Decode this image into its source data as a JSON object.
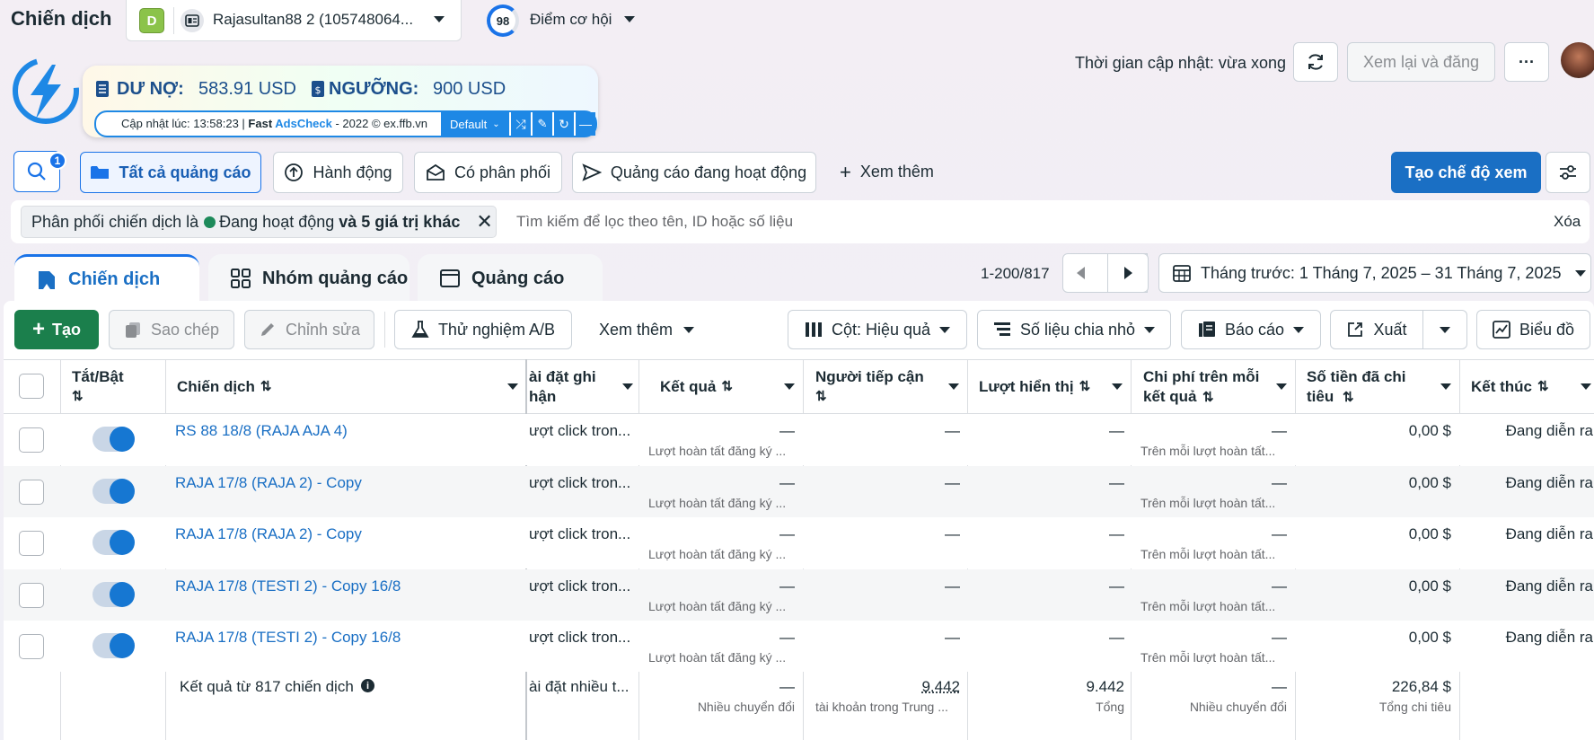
{
  "header": {
    "title": "Chiến dịch",
    "account_badge": "D",
    "account_name": "Rajasultan88 2 (105748064...",
    "score": "98",
    "score_label": "Điểm cơ hội",
    "update_time": "Thời gian cập nhật: vừa xong",
    "review_button": "Xem lại và đăng",
    "more_button": "···"
  },
  "extension": {
    "debt_label": "DƯ NỢ:",
    "debt_value": "583.91 USD",
    "threshold_label": "NGƯỠNG:",
    "threshold_value": "900 USD",
    "update_prefix": "Cập nhật lúc: 13:58:23 | ",
    "brand_fast": "Fast ",
    "brand_ads": "AdsCheck",
    "copyright": " - 2022 © ex.ffb.vn",
    "profile_select": "Default"
  },
  "toolbar": {
    "search_badge": "1",
    "all_ads": "Tất cả quảng cáo",
    "actions": "Hành động",
    "has_delivery": "Có phân phối",
    "active_ads": "Quảng cáo đang hoạt động",
    "see_more": "Xem thêm",
    "create_view": "Tạo chế độ xem"
  },
  "filter": {
    "chip_prefix": "Phân phối chiến dịch là",
    "chip_value": "Đang hoạt động",
    "chip_more": "và 5 giá trị khác",
    "search_placeholder": "Tìm kiếm để lọc theo tên, ID hoặc số liệu",
    "clear": "Xóa"
  },
  "tabs": [
    {
      "label": "Chiến dịch",
      "icon": "folder-icon"
    },
    {
      "label": "Nhóm quảng cáo",
      "icon": "grid-icon"
    },
    {
      "label": "Quảng cáo",
      "icon": "ad-icon"
    }
  ],
  "pagination": {
    "range": "1-200/817",
    "date_range": "Tháng trước: 1 Tháng 7, 2025 – 31 Tháng 7, 2025"
  },
  "actionbar": {
    "create": "Tạo",
    "duplicate": "Sao chép",
    "edit": "Chỉnh sửa",
    "ab_test": "Thử nghiệm A/B",
    "see_more": "Xem thêm",
    "columns": "Cột: Hiệu quả",
    "breakdown": "Số liệu chia nhỏ",
    "reports": "Báo cáo",
    "export": "Xuất",
    "chart": "Biểu đồ"
  },
  "table": {
    "headers": {
      "toggle": "Tắt/Bật",
      "campaign": "Chiến dịch",
      "setting": "ài đặt ghi\nhận",
      "results": "Kết quả",
      "reach": "Người tiếp cận",
      "impressions": "Lượt hiển thị",
      "cost": "Chi phí trên mỗi\nkết quả",
      "spent": "Số tiền đã chi\ntiêu",
      "end": "Kết thúc"
    },
    "rows": [
      {
        "name": "RS 88 18/8 (RAJA AJA 4)",
        "setting": "ượt click tron...",
        "result": "—",
        "result_sub": "Lượt hoàn tất đăng ký ...",
        "reach": "—",
        "impr": "—",
        "cost": "—",
        "cost_sub": "Trên mỗi lượt hoàn tất...",
        "spent": "0,00 $",
        "end": "Đang diễn ra"
      },
      {
        "name": "RAJA 17/8 (RAJA 2) - Copy",
        "setting": "ượt click tron...",
        "result": "—",
        "result_sub": "Lượt hoàn tất đăng ký ...",
        "reach": "—",
        "impr": "—",
        "cost": "—",
        "cost_sub": "Trên mỗi lượt hoàn tất...",
        "spent": "0,00 $",
        "end": "Đang diễn ra"
      },
      {
        "name": "RAJA 17/8 (RAJA 2) - Copy",
        "setting": "ượt click tron...",
        "result": "—",
        "result_sub": "Lượt hoàn tất đăng ký ...",
        "reach": "—",
        "impr": "—",
        "cost": "—",
        "cost_sub": "Trên mỗi lượt hoàn tất...",
        "spent": "0,00 $",
        "end": "Đang diễn ra"
      },
      {
        "name": "RAJA 17/8 (TESTI 2) - Copy 16/8",
        "setting": "ượt click tron...",
        "result": "—",
        "result_sub": "Lượt hoàn tất đăng ký ...",
        "reach": "—",
        "impr": "—",
        "cost": "—",
        "cost_sub": "Trên mỗi lượt hoàn tất...",
        "spent": "0,00 $",
        "end": "Đang diễn ra"
      },
      {
        "name": "RAJA 17/8 (TESTI 2) - Copy 16/8",
        "setting": "ượt click tron...",
        "result": "—",
        "result_sub": "Lượt hoàn tất đăng ký ...",
        "reach": "—",
        "impr": "—",
        "cost": "—",
        "cost_sub": "Trên mỗi lượt hoàn tất...",
        "spent": "0,00 $",
        "end": "Đang diễn ra"
      }
    ],
    "footer": {
      "label": "Kết quả từ 817 chiến dịch",
      "setting": "ài đặt nhiều t...",
      "result": "—",
      "result_sub": "Nhiều chuyển đổi",
      "reach": "9.442",
      "reach_sub": "tài khoản trong Trung ...",
      "impr": "9.442",
      "impr_sub": "Tổng",
      "cost": "—",
      "cost_sub": "Nhiều chuyển đổi",
      "spent": "226,84 $",
      "spent_sub": "Tổng chi tiêu"
    }
  }
}
